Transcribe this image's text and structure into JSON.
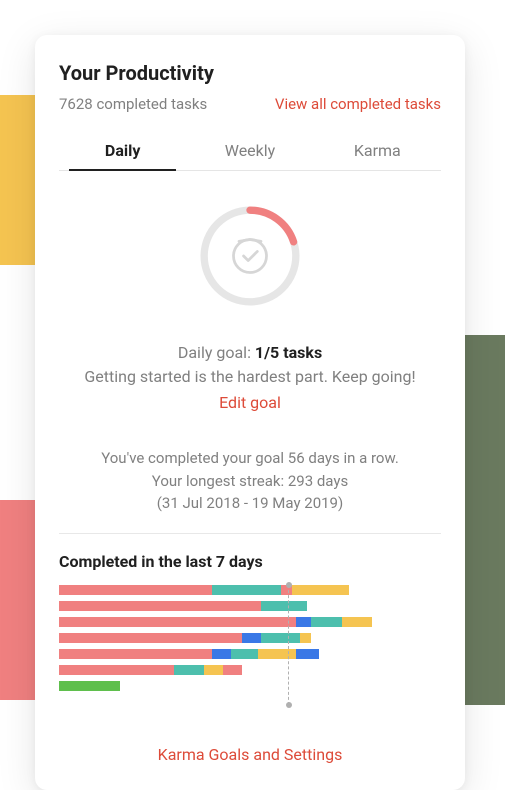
{
  "title": "Your Productivity",
  "completed_summary": "7628 completed tasks",
  "view_all": "View all completed tasks",
  "tabs": {
    "daily": "Daily",
    "weekly": "Weekly",
    "karma": "Karma"
  },
  "goal": {
    "label": "Daily goal: ",
    "value": "1/5 tasks",
    "motivation": "Getting started is the hardest part. Keep going!",
    "edit": "Edit goal",
    "progress_pct": 20
  },
  "streak": {
    "line1": "You've completed your goal 56 days in a row.",
    "line2": "Your longest streak: 293 days",
    "line3": "(31 Jul 2018 - 19 May 2019)"
  },
  "chart_title": "Completed in the last 7 days",
  "chart_data": {
    "type": "bar",
    "orientation": "horizontal",
    "stacked": true,
    "title": "Completed in the last 7 days",
    "xlabel": "",
    "ylabel": "",
    "goal_line_pct": 60,
    "colors": {
      "coral": "#f08080",
      "teal": "#4dbfad",
      "yellow": "#f5c451",
      "blue": "#3a78e6",
      "green": "#5fbf4d"
    },
    "rows": [
      {
        "segments": [
          {
            "color": "coral",
            "pct": 40
          },
          {
            "color": "teal",
            "pct": 18
          },
          {
            "color": "coral",
            "pct": 3
          },
          {
            "color": "yellow",
            "pct": 15
          }
        ]
      },
      {
        "segments": [
          {
            "color": "coral",
            "pct": 53
          },
          {
            "color": "teal",
            "pct": 12
          }
        ]
      },
      {
        "segments": [
          {
            "color": "coral",
            "pct": 62
          },
          {
            "color": "blue",
            "pct": 4
          },
          {
            "color": "teal",
            "pct": 8
          },
          {
            "color": "yellow",
            "pct": 8
          }
        ]
      },
      {
        "segments": [
          {
            "color": "coral",
            "pct": 48
          },
          {
            "color": "blue",
            "pct": 5
          },
          {
            "color": "teal",
            "pct": 10
          },
          {
            "color": "yellow",
            "pct": 3
          }
        ]
      },
      {
        "segments": [
          {
            "color": "coral",
            "pct": 40
          },
          {
            "color": "blue",
            "pct": 5
          },
          {
            "color": "teal",
            "pct": 7
          },
          {
            "color": "yellow",
            "pct": 10
          },
          {
            "color": "blue",
            "pct": 6
          }
        ]
      },
      {
        "segments": [
          {
            "color": "coral",
            "pct": 30
          },
          {
            "color": "teal",
            "pct": 8
          },
          {
            "color": "yellow",
            "pct": 5
          },
          {
            "color": "coral",
            "pct": 5
          }
        ]
      },
      {
        "segments": [
          {
            "color": "green",
            "pct": 16
          }
        ]
      }
    ]
  },
  "footer": "Karma Goals and Settings"
}
